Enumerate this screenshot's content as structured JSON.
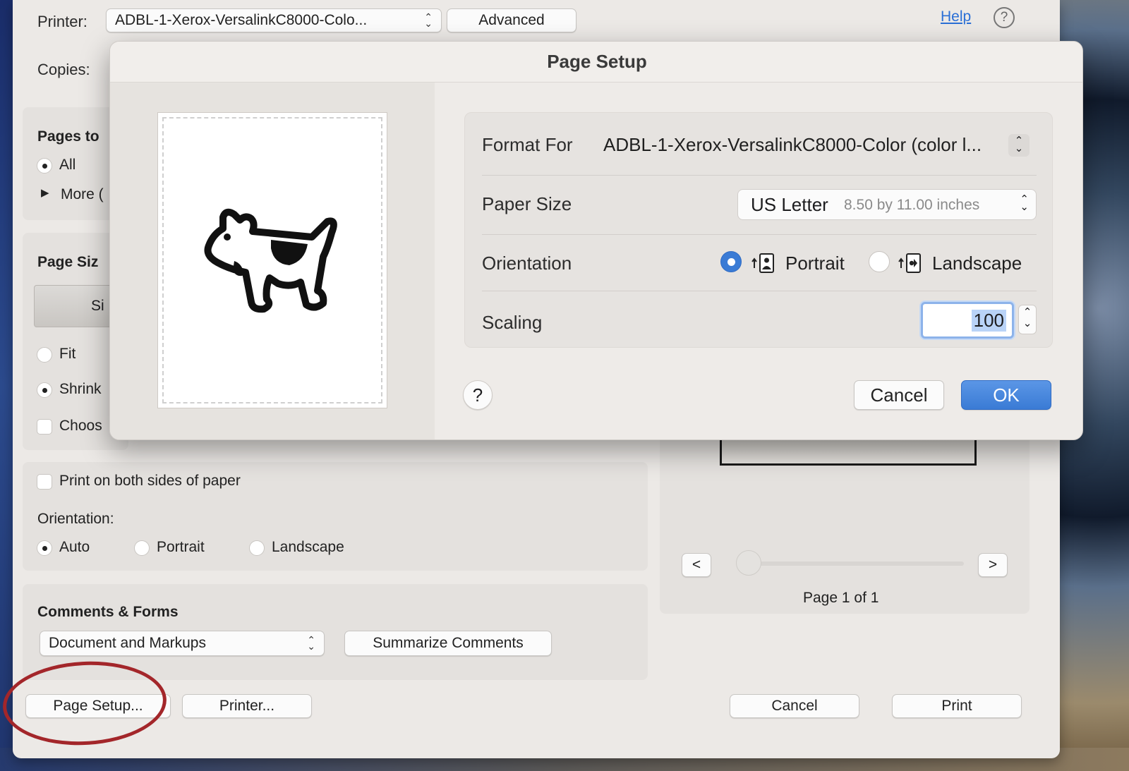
{
  "print_dialog": {
    "printer_label": "Printer:",
    "printer_value": "ADBL-1-Xerox-VersalinkC8000-Colo...",
    "advanced_button": "Advanced",
    "help_link": "Help",
    "copies_label": "Copies:",
    "pages_section": {
      "title": "Pages to",
      "all_label": "All",
      "more_label": "More ("
    },
    "page_size_section": {
      "title": "Page Siz",
      "size_button": "Si",
      "fit_label": "Fit",
      "shrink_label": "Shrink",
      "choose_label": "Choos"
    },
    "duplex_label": "Print on both sides of paper",
    "orientation_label": "Orientation:",
    "orientation_options": [
      "Auto",
      "Portrait",
      "Landscape"
    ],
    "preview": {
      "prev_button": "<",
      "next_button": ">",
      "page_indicator": "Page 1 of 1"
    },
    "comments_forms": {
      "title": "Comments & Forms",
      "select_value": "Document and Markups",
      "summarize_button": "Summarize Comments"
    },
    "page_setup_button": "Page Setup...",
    "printer_button": "Printer...",
    "cancel_button": "Cancel",
    "print_button": "Print"
  },
  "page_setup_sheet": {
    "title": "Page Setup",
    "format_for_label": "Format For",
    "format_for_value": "ADBL-1-Xerox-VersalinkC8000-Color (color l...",
    "paper_size_label": "Paper Size",
    "paper_size_value": "US Letter",
    "paper_size_dimensions": "8.50 by 11.00 inches",
    "orientation_label": "Orientation",
    "portrait_label": "Portrait",
    "landscape_label": "Landscape",
    "scaling_label": "Scaling",
    "scaling_value": "100",
    "help_button": "?",
    "cancel_button": "Cancel",
    "ok_button": "OK"
  },
  "colors": {
    "accent": "#3a7bd5",
    "annotation_circle": "#a3262a"
  },
  "icons": [
    "help-circle-icon",
    "dogcow-icon",
    "portrait-orientation-icon",
    "landscape-orientation-icon",
    "stepper-icon",
    "disclosure-triangle-icon"
  ]
}
